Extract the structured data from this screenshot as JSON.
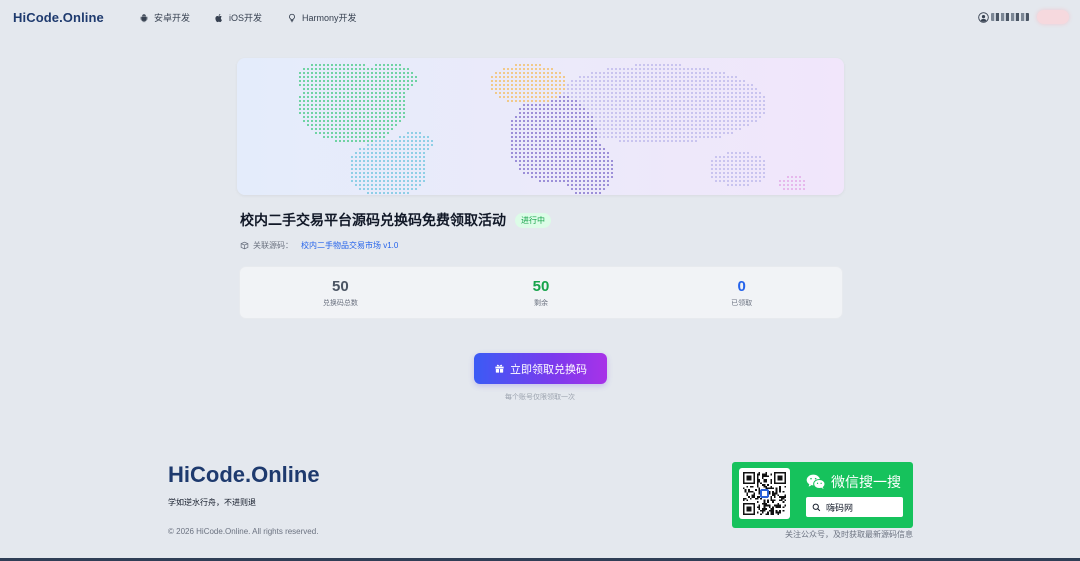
{
  "nav": {
    "logo": "HiCode.Online",
    "items": [
      {
        "label": "安卓开发",
        "icon": "android-icon"
      },
      {
        "label": "iOS开发",
        "icon": "apple-icon"
      },
      {
        "label": "Harmony开发",
        "icon": "lightbulb-icon"
      }
    ]
  },
  "activity": {
    "title": "校内二手交易平台源码兑换码免费领取活动",
    "status": "进行中",
    "source_label": "关联源码：",
    "source_link": "校内二手物品交易市场 v1.0"
  },
  "stats": [
    {
      "value": "50",
      "label": "兑换码总数",
      "color": "#4b5563"
    },
    {
      "value": "50",
      "label": "剩余",
      "color": "#16a34a"
    },
    {
      "value": "0",
      "label": "已领取",
      "color": "#2563eb"
    }
  ],
  "cta": {
    "label": "立即领取兑换码",
    "hint": "每个账号仅限领取一次"
  },
  "footer": {
    "logo": "HiCode.Online",
    "slogan": "学如逆水行舟，不进则退",
    "copyright": "© 2026 HiCode.Online. All rights reserved.",
    "wechat": {
      "title": "微信搜一搜",
      "search_text": "嗨码网",
      "caption": "关注公众号，及时获取最新源码信息"
    }
  },
  "colors": {
    "brand": "#1e3a6e",
    "accent_start": "#3b5bf5",
    "accent_end": "#a832e8",
    "wechat_green": "#16c25c"
  }
}
